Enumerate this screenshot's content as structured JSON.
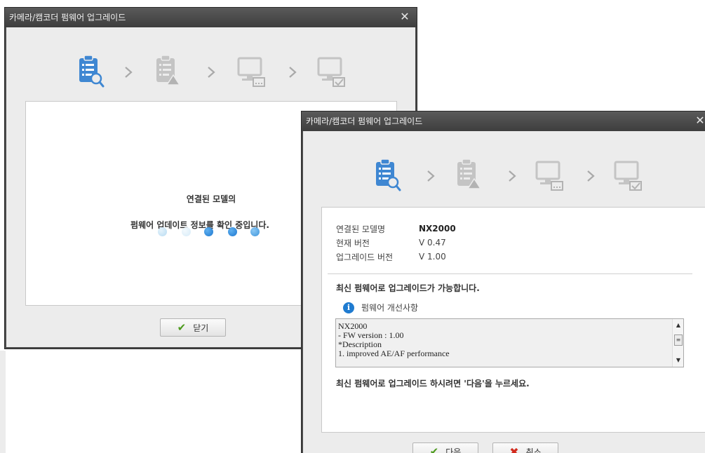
{
  "dialog_loading": {
    "title": "카메라/캠코더 펌웨어 업그레이드",
    "close_glyph": "✕",
    "message_line1": "연결된 모델의",
    "message_line2": "펌웨어 업데이트 정보를 확인 중입니다.",
    "close_button_label": "닫기"
  },
  "dialog_update": {
    "title": "카메라/캠코더 펌웨어 업그레이드",
    "close_glyph": "✕",
    "info": {
      "model_label": "연결된 모델명",
      "model_value": "NX2000",
      "current_label": "현재 버전",
      "current_value": "V 0.47",
      "upgrade_label": "업그레이드 버전",
      "upgrade_value": "V 1.00"
    },
    "available_text": "최신 펌웨어로 업그레이드가 가능합니다.",
    "notes_title": "펌웨어 개선사항",
    "release_notes": "NX2000\n- FW version : 1.00\n*Description\n1. improved AE/AF performance",
    "proceed_text": "최신 펌웨어로 업그레이드 하시려면 '다음'을 누르세요.",
    "next_button_label": "다음",
    "cancel_button_label": "취소"
  },
  "icons": {
    "step1": "checklist-search-icon",
    "step2": "checklist-warning-icon",
    "step3": "computer-transfer-icon",
    "step4": "computer-check-icon",
    "arrow": "chevron-right-icon",
    "info": "info-icon",
    "check": "checkmark-icon",
    "cancel": "x-icon"
  },
  "colors": {
    "active_step": "#3f87d2",
    "inactive_step": "#bfbfbf",
    "titlebar": "#4a4a4a",
    "dot_light": "#b7dbf2",
    "dot_dark": "#1e78cf"
  }
}
